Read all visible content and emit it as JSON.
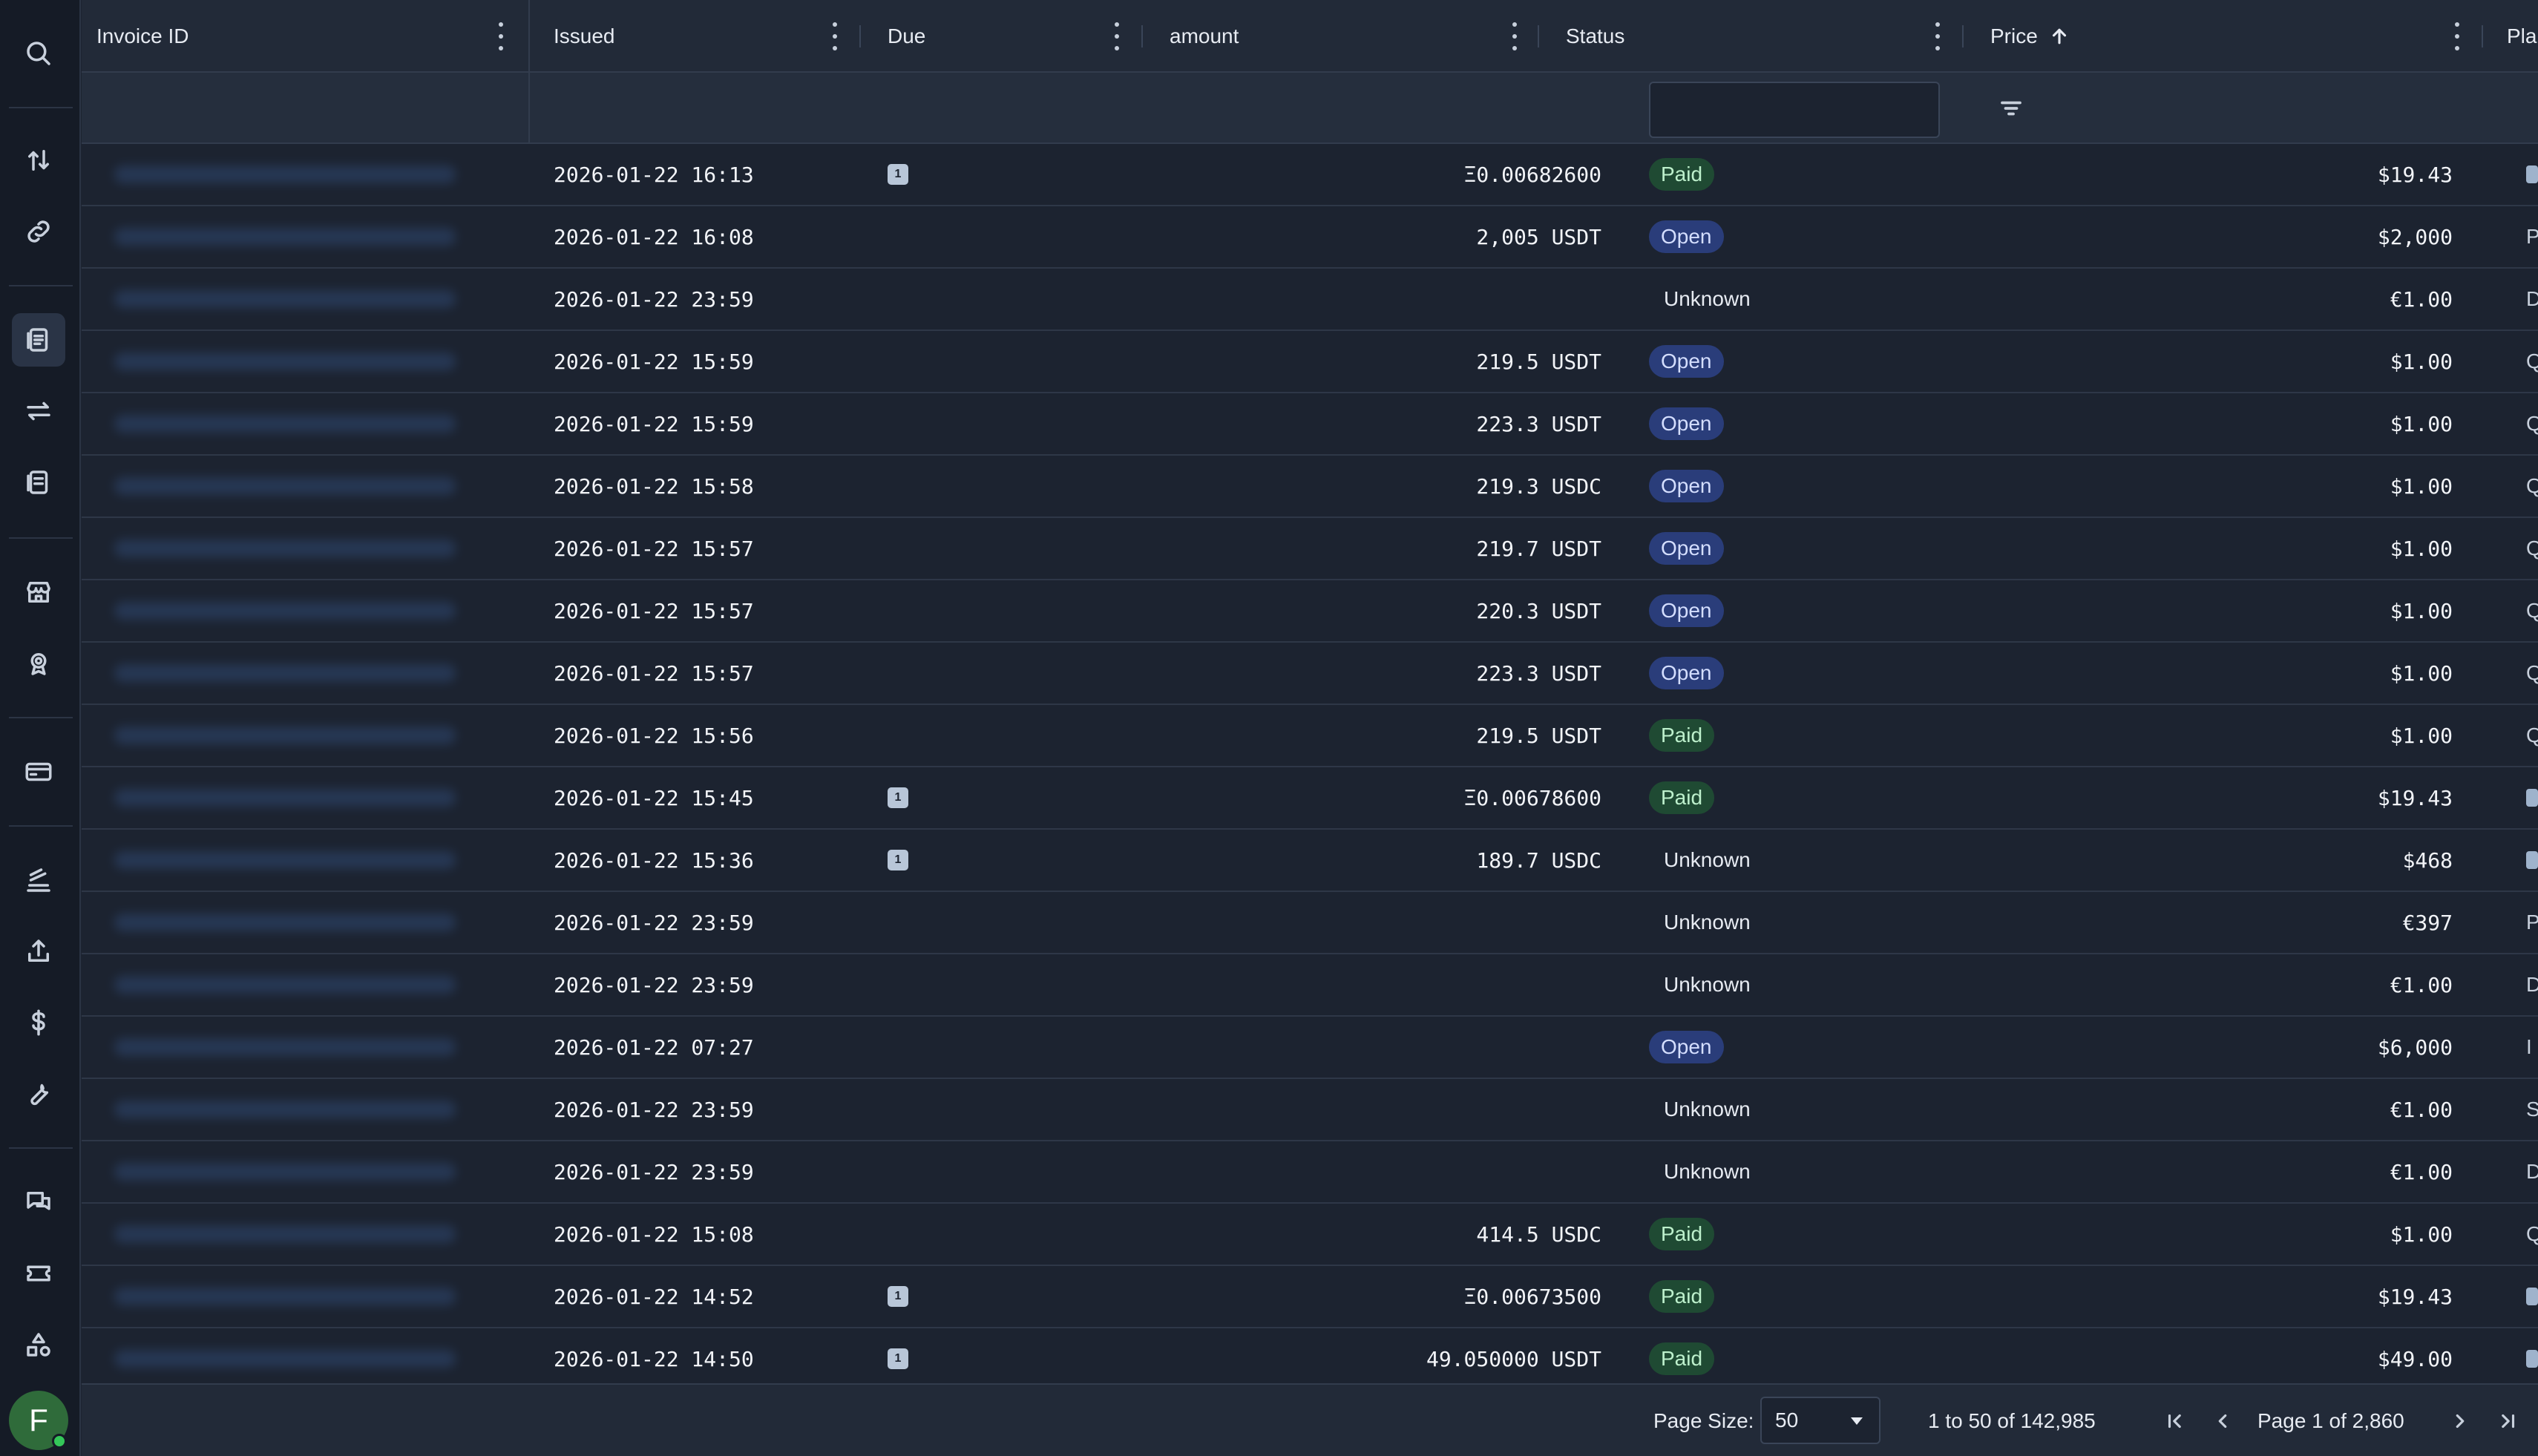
{
  "columns": {
    "invoice_id": "Invoice ID",
    "issued": "Issued",
    "due": "Due",
    "amount": "amount",
    "status": "Status",
    "price": "Price",
    "plan": "Pla"
  },
  "colors": {
    "background": "#1c2330",
    "paid_badge": "#1f4a33",
    "open_badge": "#2a3d7a",
    "accent_avatar": "#2f6b3a"
  },
  "rail": {
    "icons": [
      "search-icon",
      "transfer-icon",
      "link-icon",
      "invoice-icon",
      "swap-icon",
      "receipt-icon",
      "store-icon",
      "award-icon",
      "card-icon",
      "stack-icon",
      "upload-icon",
      "dollar-icon",
      "wrench-icon",
      "chat-icon",
      "ticket-icon",
      "shapes-icon"
    ],
    "active": "invoice-icon",
    "avatar_initial": "F"
  },
  "rows": [
    {
      "issued": "2026-01-22 16:13",
      "due": "1",
      "amount": "Ξ0.00682600",
      "status": "Paid",
      "price": "$19.43",
      "plan": "chip"
    },
    {
      "issued": "2026-01-22 16:08",
      "due": "",
      "amount": "2,005 USDT",
      "status": "Open",
      "price": "$2,000",
      "plan": "P"
    },
    {
      "issued": "2026-01-22 23:59",
      "due": "",
      "amount": "",
      "status": "Unknown",
      "price": "€1.00",
      "plan": "D"
    },
    {
      "issued": "2026-01-22 15:59",
      "due": "",
      "amount": "219.5 USDT",
      "status": "Open",
      "price": "$1.00",
      "plan": "Q"
    },
    {
      "issued": "2026-01-22 15:59",
      "due": "",
      "amount": "223.3 USDT",
      "status": "Open",
      "price": "$1.00",
      "plan": "Q"
    },
    {
      "issued": "2026-01-22 15:58",
      "due": "",
      "amount": "219.3 USDC",
      "status": "Open",
      "price": "$1.00",
      "plan": "Q"
    },
    {
      "issued": "2026-01-22 15:57",
      "due": "",
      "amount": "219.7 USDT",
      "status": "Open",
      "price": "$1.00",
      "plan": "Q"
    },
    {
      "issued": "2026-01-22 15:57",
      "due": "",
      "amount": "220.3 USDT",
      "status": "Open",
      "price": "$1.00",
      "plan": "Q"
    },
    {
      "issued": "2026-01-22 15:57",
      "due": "",
      "amount": "223.3 USDT",
      "status": "Open",
      "price": "$1.00",
      "plan": "Q"
    },
    {
      "issued": "2026-01-22 15:56",
      "due": "",
      "amount": "219.5 USDT",
      "status": "Paid",
      "price": "$1.00",
      "plan": "Q"
    },
    {
      "issued": "2026-01-22 15:45",
      "due": "1",
      "amount": "Ξ0.00678600",
      "status": "Paid",
      "price": "$19.43",
      "plan": "chip"
    },
    {
      "issued": "2026-01-22 15:36",
      "due": "1",
      "amount": "189.7 USDC",
      "status": "Unknown",
      "price": "$468",
      "plan": "chip"
    },
    {
      "issued": "2026-01-22 23:59",
      "due": "",
      "amount": "",
      "status": "Unknown",
      "price": "€397",
      "plan": "P"
    },
    {
      "issued": "2026-01-22 23:59",
      "due": "",
      "amount": "",
      "status": "Unknown",
      "price": "€1.00",
      "plan": "D"
    },
    {
      "issued": "2026-01-22 07:27",
      "due": "",
      "amount": "",
      "status": "Open",
      "price": "$6,000",
      "plan": "I"
    },
    {
      "issued": "2026-01-22 23:59",
      "due": "",
      "amount": "",
      "status": "Unknown",
      "price": "€1.00",
      "plan": "S"
    },
    {
      "issued": "2026-01-22 23:59",
      "due": "",
      "amount": "",
      "status": "Unknown",
      "price": "€1.00",
      "plan": "D"
    },
    {
      "issued": "2026-01-22 15:08",
      "due": "",
      "amount": "414.5 USDC",
      "status": "Paid",
      "price": "$1.00",
      "plan": "Q"
    },
    {
      "issued": "2026-01-22 14:52",
      "due": "1",
      "amount": "Ξ0.00673500",
      "status": "Paid",
      "price": "$19.43",
      "plan": "chip"
    },
    {
      "issued": "2026-01-22 14:50",
      "due": "1",
      "amount": "49.050000 USDT",
      "status": "Paid",
      "price": "$49.00",
      "plan": "chip"
    }
  ],
  "pagination": {
    "page_size_label": "Page Size:",
    "page_size_value": "50",
    "range_text": "1 to 50 of 142,985",
    "page_text": "Page 1 of 2,860"
  }
}
